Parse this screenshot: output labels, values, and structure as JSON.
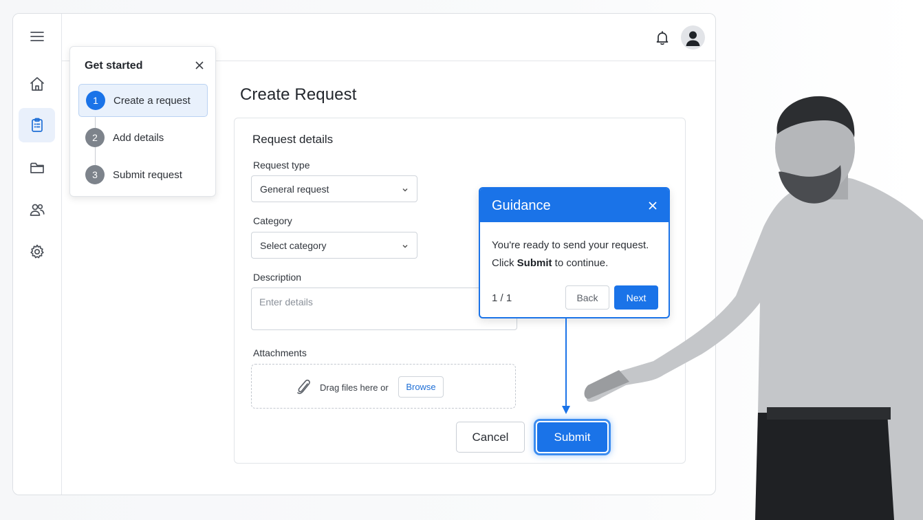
{
  "header": {
    "page_title": "Create Request"
  },
  "form": {
    "section_title": "Request details",
    "request_type_label": "Request type",
    "request_type_value": "General request",
    "category_label": "Category",
    "category_value": "Select category",
    "description_label": "Description",
    "description_placeholder": "Enter details",
    "attachments_label": "Attachments",
    "dropzone_text": "Drag files here or",
    "browse_label": "Browse",
    "cancel_label": "Cancel",
    "submit_label": "Submit"
  },
  "get_started": {
    "title": "Get started",
    "steps": [
      {
        "num": "1",
        "label": "Create a request"
      },
      {
        "num": "2",
        "label": "Add details"
      },
      {
        "num": "3",
        "label": "Submit request"
      }
    ]
  },
  "guidance": {
    "title": "Guidance",
    "line1": "You're ready to send your request.",
    "line2_pre": "Click ",
    "line2_bold": "Submit",
    "line2_post": " to continue.",
    "counter": "1 / 1",
    "back_label": "Back",
    "next_label": "Next"
  },
  "sidebar": {
    "icons": [
      "menu-icon",
      "home-icon",
      "clipboard-icon",
      "folder-icon",
      "users-icon",
      "settings-icon"
    ]
  },
  "colors": {
    "accent": "#1a73e8",
    "active_bg": "#e9f0fb"
  }
}
